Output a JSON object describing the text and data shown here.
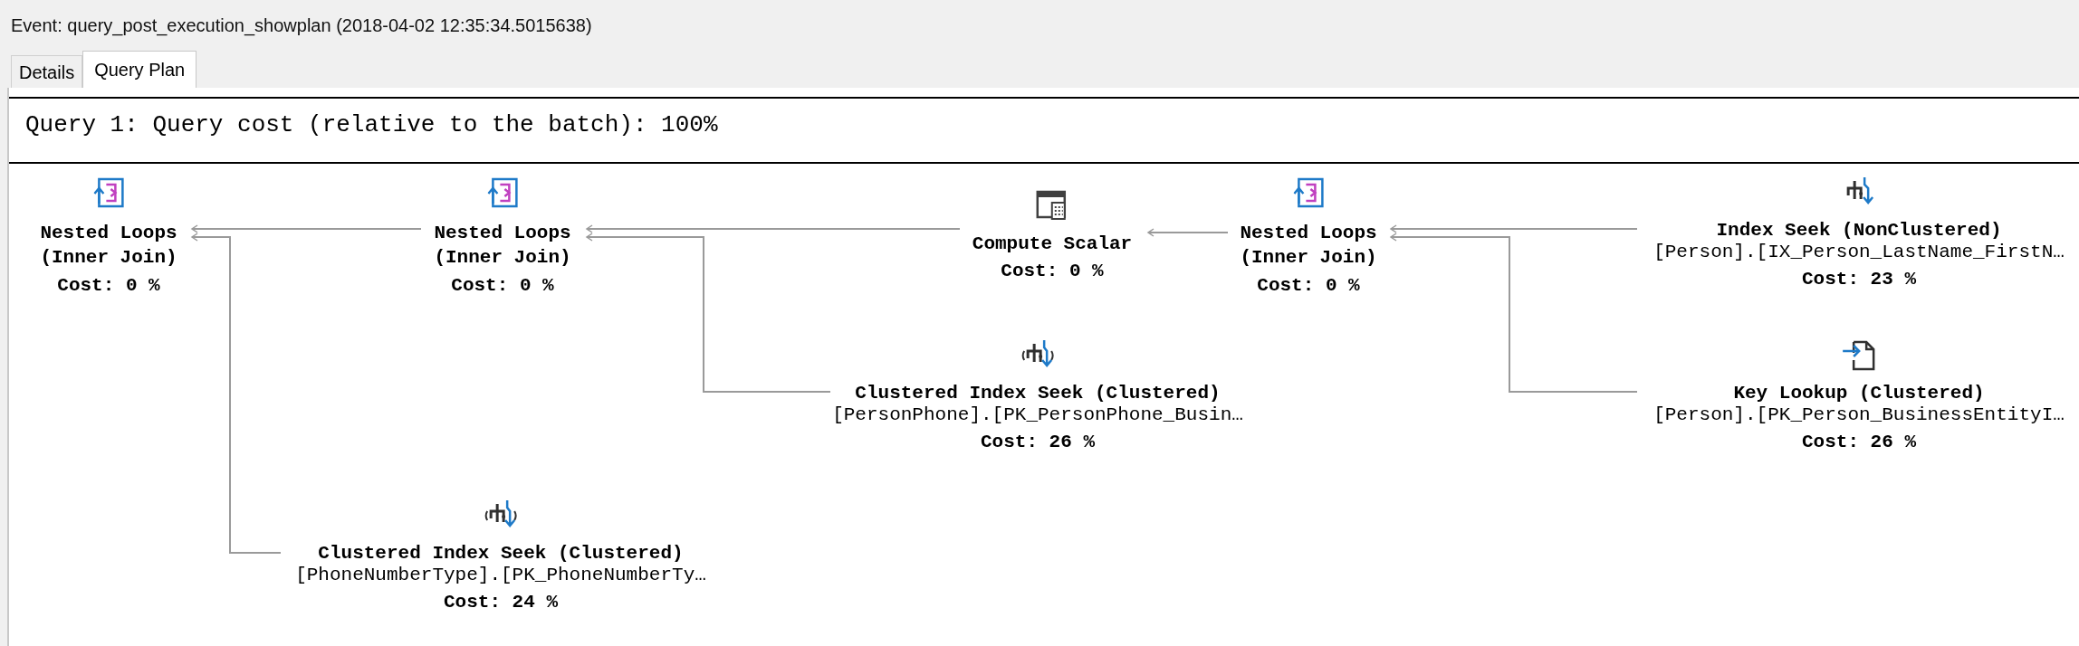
{
  "window": {
    "title": "Event: query_post_execution_showplan (2018-04-02 12:35:34.5015638)"
  },
  "tabs": [
    {
      "label": "Details",
      "selected": false
    },
    {
      "label": "Query Plan",
      "selected": true
    }
  ],
  "plan": {
    "query_header": "Query 1: Query cost (relative to the batch): 100%",
    "nodes": [
      {
        "kind": "nested_loops",
        "lines": [
          "Nested Loops",
          "(Inner Join)"
        ],
        "cost": "Cost: 0 %"
      },
      {
        "kind": "nested_loops",
        "lines": [
          "Nested Loops",
          "(Inner Join)"
        ],
        "cost": "Cost: 0 %"
      },
      {
        "kind": "compute_scalar",
        "lines": [
          "Compute Scalar"
        ],
        "cost": "Cost: 0 %"
      },
      {
        "kind": "nested_loops",
        "lines": [
          "Nested Loops",
          "(Inner Join)"
        ],
        "cost": "Cost: 0 %"
      },
      {
        "kind": "index_seek",
        "lines": [
          "Index Seek (NonClustered)",
          "[Person].[IX_Person_LastName_FirstN…"
        ],
        "cost": "Cost: 23 %"
      },
      {
        "kind": "clustered_index_seek",
        "lines": [
          "Clustered Index Seek (Clustered)",
          "[PersonPhone].[PK_PersonPhone_Busin…"
        ],
        "cost": "Cost: 26 %"
      },
      {
        "kind": "key_lookup",
        "lines": [
          "Key Lookup (Clustered)",
          "[Person].[PK_Person_BusinessEntityI…"
        ],
        "cost": "Cost: 26 %"
      },
      {
        "kind": "clustered_index_seek",
        "lines": [
          "Clustered Index Seek (Clustered)",
          "[PhoneNumberType].[PK_PhoneNumberTy…"
        ],
        "cost": "Cost: 24 %"
      }
    ]
  }
}
